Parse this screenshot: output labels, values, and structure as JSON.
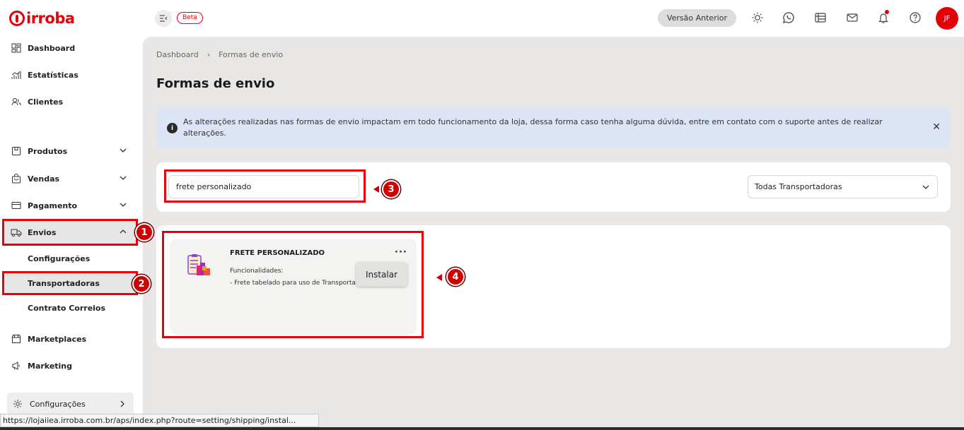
{
  "brand": {
    "name": "irroba",
    "color": "#e3000b"
  },
  "header": {
    "beta_label": "Beta",
    "previous_version_label": "Versão Anterior",
    "icons": [
      "sun-icon",
      "whatsapp-icon",
      "calendar-icon",
      "mail-icon",
      "bell-icon",
      "help-icon"
    ],
    "avatar_initials": "JF"
  },
  "sidebar": {
    "items": [
      {
        "label": "Dashboard",
        "icon": "dashboard-icon"
      },
      {
        "label": "Estatísticas",
        "icon": "chart-icon"
      },
      {
        "label": "Clientes",
        "icon": "users-icon"
      },
      {
        "label": "Produtos",
        "icon": "box-icon"
      },
      {
        "label": "Vendas",
        "icon": "bag-icon"
      },
      {
        "label": "Pagamento",
        "icon": "card-icon"
      },
      {
        "label": "Envios",
        "icon": "truck-icon"
      },
      {
        "label": "Marketplaces",
        "icon": "store-icon"
      },
      {
        "label": "Marketing",
        "icon": "megaphone-icon"
      }
    ],
    "envios_sub": [
      "Configurações",
      "Transportadoras",
      "Contrato Correios"
    ],
    "config_label": "Configurações"
  },
  "main": {
    "breadcrumb": [
      "Dashboard",
      "Formas de envio"
    ],
    "title": "Formas de envio",
    "alert_text": "As alterações realizadas nas formas de envio impactam em todo funcionamento da loja, dessa forma caso tenha alguma dúvida, entre em contato com o suporte antes de realizar alterações.",
    "search_value": "frete personalizado",
    "carrier_select": "Todas Transportadoras",
    "app_card": {
      "title": "FRETE PERSONALIZADO",
      "subtitle": "Funcionalidades:",
      "feature": "- Frete tabelado para uso de Transportadoras",
      "install_label": "Instalar"
    }
  },
  "annotations": [
    "1",
    "2",
    "3",
    "4"
  ],
  "status_url": "https://lojaiiea.irroba.com.br/aps/index.php?route=setting/shipping/instal..."
}
